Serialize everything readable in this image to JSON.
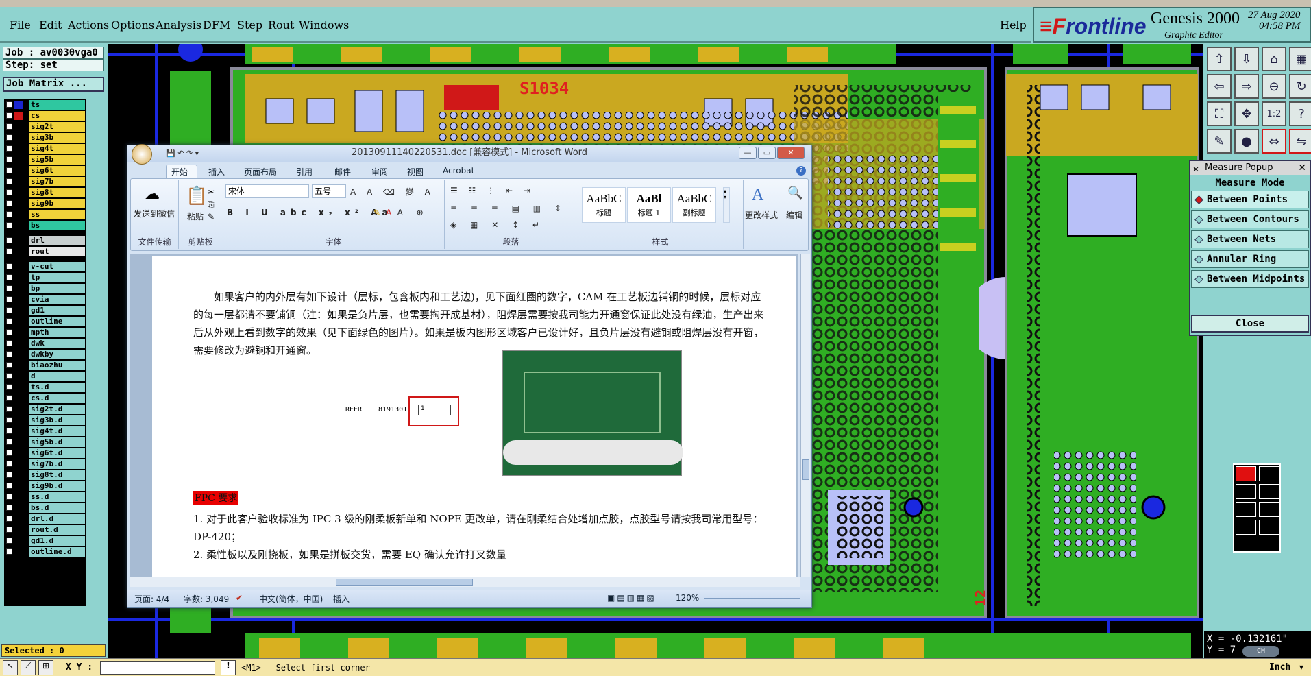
{
  "menubar": {
    "items": [
      "File",
      "Edit",
      "Actions",
      "Options",
      "Analysis",
      "DFM",
      "Step",
      "Rout",
      "Windows"
    ],
    "help": "Help"
  },
  "brand": {
    "logo_prefix": "F",
    "logo_rest": "rontline",
    "product": "Genesis 2000",
    "subtitle": "Graphic Editor",
    "date": "27 Aug 2020",
    "time": "04:58 PM"
  },
  "job": {
    "job": "Job : av0030vga0",
    "step": "Step: set",
    "matrix": "Job Matrix ..."
  },
  "layers": [
    {
      "name": "ts",
      "color": "#2fc7a0",
      "sw": "#1a26d0"
    },
    {
      "name": "cs",
      "color": "#f0d23a",
      "sw": "#d01818"
    },
    {
      "name": "sig2t",
      "color": "#f0d23a",
      "sw": "#000"
    },
    {
      "name": "sig3b",
      "color": "#f0d23a",
      "sw": "#000"
    },
    {
      "name": "sig4t",
      "color": "#f0d23a",
      "sw": "#000"
    },
    {
      "name": "sig5b",
      "color": "#f0d23a",
      "sw": "#000"
    },
    {
      "name": "sig6t",
      "color": "#f0d23a",
      "sw": "#000"
    },
    {
      "name": "sig7b",
      "color": "#f0d23a",
      "sw": "#000"
    },
    {
      "name": "sig8t",
      "color": "#f0d23a",
      "sw": "#000"
    },
    {
      "name": "sig9b",
      "color": "#f0d23a",
      "sw": "#000"
    },
    {
      "name": "ss",
      "color": "#f0d23a",
      "sw": "#000"
    },
    {
      "name": "bs",
      "color": "#2fc7a0",
      "sw": "#000"
    },
    {
      "name": "drl",
      "color": "#c9d0d0",
      "sw": "#000"
    },
    {
      "name": "rout",
      "color": "#e8e8e8",
      "sw": "#000"
    },
    {
      "name": "v-cut",
      "color": "#8fd3cf",
      "sw": "#000"
    },
    {
      "name": "tp",
      "color": "#8fd3cf",
      "sw": "#000"
    },
    {
      "name": "bp",
      "color": "#8fd3cf",
      "sw": "#000"
    },
    {
      "name": "cvia",
      "color": "#8fd3cf",
      "sw": "#000"
    },
    {
      "name": "gd1",
      "color": "#8fd3cf",
      "sw": "#000"
    },
    {
      "name": "outline",
      "color": "#8fd3cf",
      "sw": "#000"
    },
    {
      "name": "mpth",
      "color": "#8fd3cf",
      "sw": "#000"
    },
    {
      "name": "dwk",
      "color": "#8fd3cf",
      "sw": "#000"
    },
    {
      "name": "dwkby",
      "color": "#8fd3cf",
      "sw": "#000"
    },
    {
      "name": "biaozhu",
      "color": "#8fd3cf",
      "sw": "#000"
    },
    {
      "name": "d",
      "color": "#8fd3cf",
      "sw": "#000"
    },
    {
      "name": "ts.d",
      "color": "#8fd3cf",
      "sw": "#000"
    },
    {
      "name": "cs.d",
      "color": "#8fd3cf",
      "sw": "#000"
    },
    {
      "name": "sig2t.d",
      "color": "#8fd3cf",
      "sw": "#000"
    },
    {
      "name": "sig3b.d",
      "color": "#8fd3cf",
      "sw": "#000"
    },
    {
      "name": "sig4t.d",
      "color": "#8fd3cf",
      "sw": "#000"
    },
    {
      "name": "sig5b.d",
      "color": "#8fd3cf",
      "sw": "#000"
    },
    {
      "name": "sig6t.d",
      "color": "#8fd3cf",
      "sw": "#000"
    },
    {
      "name": "sig7b.d",
      "color": "#8fd3cf",
      "sw": "#000"
    },
    {
      "name": "sig8t.d",
      "color": "#8fd3cf",
      "sw": "#000"
    },
    {
      "name": "sig9b.d",
      "color": "#8fd3cf",
      "sw": "#000"
    },
    {
      "name": "ss.d",
      "color": "#8fd3cf",
      "sw": "#000"
    },
    {
      "name": "bs.d",
      "color": "#8fd3cf",
      "sw": "#000"
    },
    {
      "name": "drl.d",
      "color": "#8fd3cf",
      "sw": "#000"
    },
    {
      "name": "rout.d",
      "color": "#8fd3cf",
      "sw": "#000"
    },
    {
      "name": "gd1.d",
      "color": "#8fd3cf",
      "sw": "#000"
    },
    {
      "name": "outline.d",
      "color": "#8fd3cf",
      "sw": "#000"
    }
  ],
  "selected": "Selected : 0",
  "pcb": {
    "ref_label": "S1034",
    "edge_label": "12"
  },
  "measure": {
    "header": "Measure Popup",
    "title": "Measure Mode",
    "options": [
      "Between Points",
      "Between Contours",
      "Between Nets",
      "Annular Ring",
      "Between Midpoints"
    ],
    "close": "Close"
  },
  "coords": {
    "x": "X = -0.132161\"",
    "y": "Y = 7"
  },
  "status": {
    "xy_label": "X Y :",
    "prompt": "<M1> - Select first corner",
    "units": "Inch",
    "ch": "CH"
  },
  "word": {
    "title": "20130911140220531.doc [兼容模式] - Microsoft Word",
    "tabs": [
      "开始",
      "插入",
      "页面布局",
      "引用",
      "邮件",
      "审阅",
      "视图",
      "Acrobat"
    ],
    "groups": {
      "send": "发送到微信",
      "send_group": "文件传输",
      "paste": "粘贴",
      "clipboard": "剪贴板",
      "font_group": "字体",
      "para_group": "段落",
      "styles_group": "样式",
      "edit": "编辑",
      "change_style": "更改样式",
      "font_name": "宋体",
      "font_size": "五号"
    },
    "styles": [
      {
        "sample": "AaBbC",
        "name": "标题"
      },
      {
        "sample": "AaBl",
        "name": "标题 1"
      },
      {
        "sample": "AaBbC",
        "name": "副标题"
      }
    ],
    "para1": "如果客户的内外层有如下设计（层标，包含板内和工艺边)，见下面红圈的数字，CAM 在工艺板边铺铜的时候，层标对应的每一层都请不要铺铜（注：如果是负片层，也需要掏开成基材），阻焊层需要按我司能力开通窗保证此处没有绿油，生产出来后从外观上看到数字的效果（见下面绿色的图片）。如果是板内图形区域客户已设计好，且负片层没有避铜或阻焊层没有开窗，需要修改为避铜和开通窗。",
    "fig_left": "REER",
    "fig_num": "8191301",
    "fig_box": "1",
    "fpc_heading": "FPC 要求",
    "item1": "1. 对于此客户验收标准为 IPC 3 级的刚柔板新单和 NOPE 更改单，请在刚柔结合处增加点胶，点胶型号请按我司常用型号：DP-420；",
    "item2": "2. 柔性板以及刚挠板，如果是拼板交货，需要 EQ 确认允许打叉数量",
    "status": {
      "page": "页面: 4/4",
      "words": "字数: 3,049",
      "lang": "中文(简体，中国)",
      "mode": "插入",
      "zoom": "120%"
    }
  }
}
